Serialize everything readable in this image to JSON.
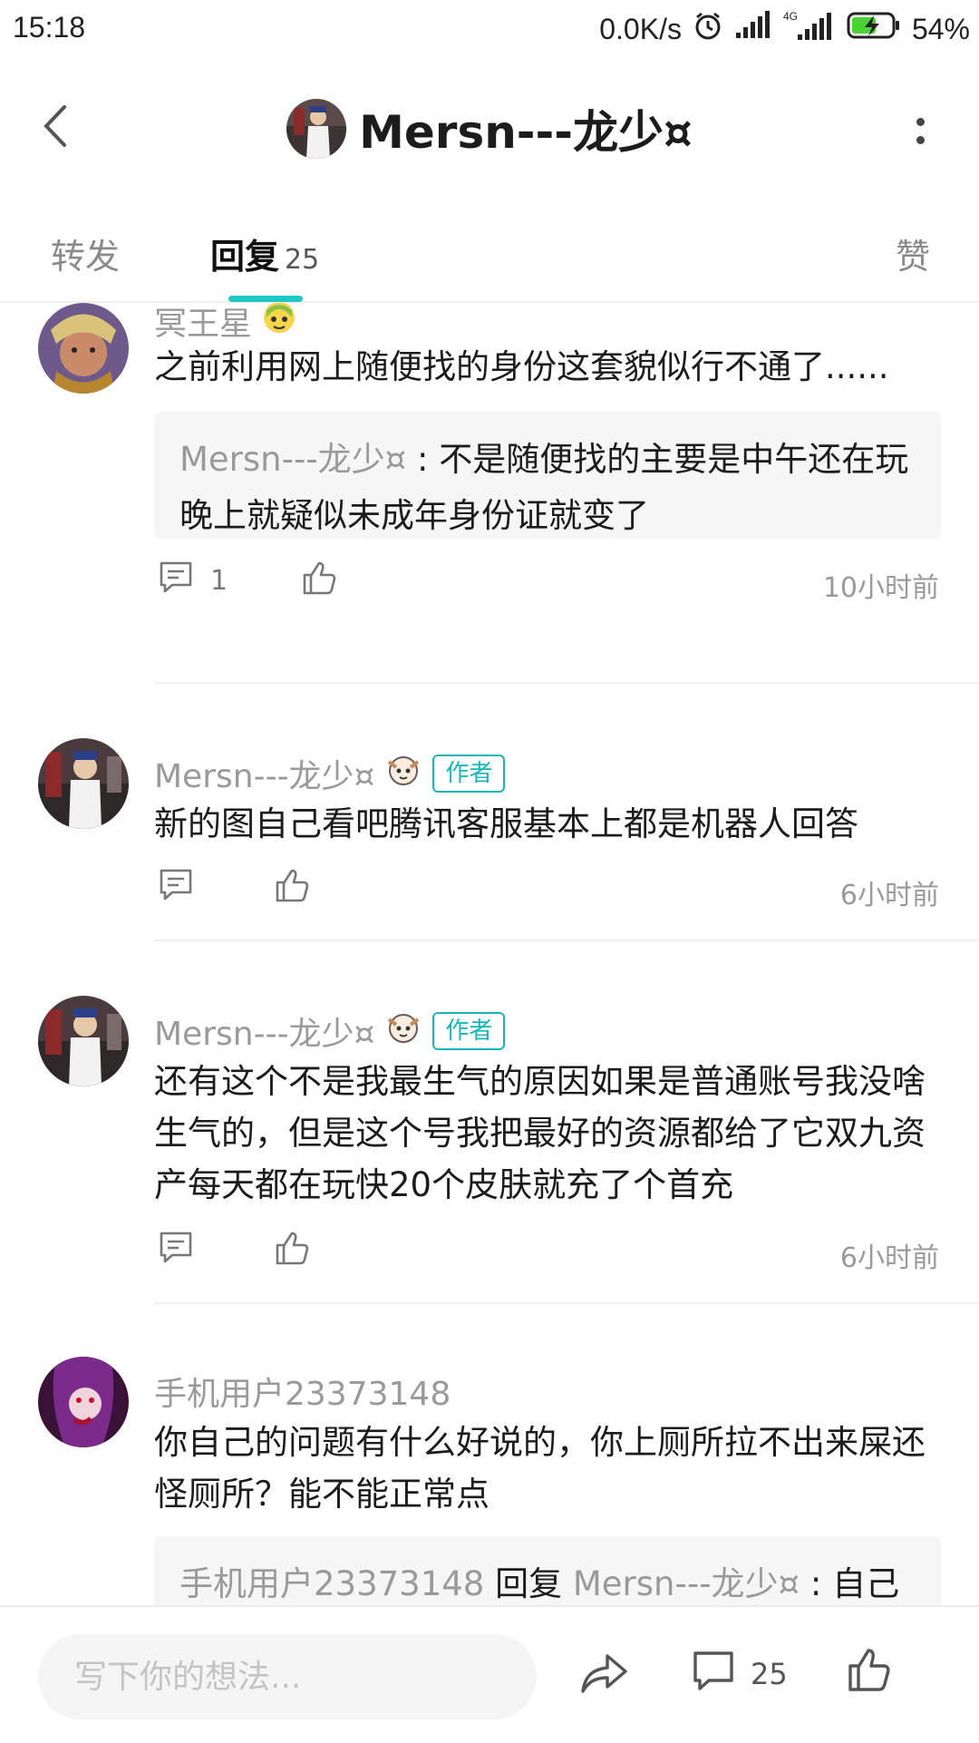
{
  "status_bar": {
    "time": "15:18",
    "net_speed": "0.0K/s",
    "network_type": "4G",
    "battery": "54%",
    "icons": [
      "alarm-icon",
      "signal-icon",
      "signal-4g-icon",
      "battery-charging-icon"
    ]
  },
  "header": {
    "title": "Mersn---龙少¤",
    "back_icon": "chevron-left-icon",
    "more_icon": "more-vertical-icon"
  },
  "tabs": {
    "forward": "转发",
    "reply": "回复",
    "reply_count": "25",
    "like": "赞",
    "accent": "#1ec8c8"
  },
  "comments": [
    {
      "name": "冥王星",
      "text": "之前利用网上随便找的身份这套貌似行不通了......",
      "quote_name": "Mersn---龙少¤",
      "quote_sep": " : ",
      "quote_text": "不是随便找的主要是中午还在玩晚上就疑似未成年身份证就变了",
      "reply_count": "1",
      "time": "10小时前"
    },
    {
      "name": "Mersn---龙少¤",
      "badge": "作者",
      "text": "新的图自己看吧腾讯客服基本上都是机器人回答",
      "time": "6小时前"
    },
    {
      "name": "Mersn---龙少¤",
      "badge": "作者",
      "text": "还有这个不是我最生气的原因如果是普通账号我没啥生气的，但是这个号我把最好的资源都给了它双九资产每天都在玩快20个皮肤就充了个首充",
      "time": "6小时前"
    },
    {
      "name": "手机用户23373148",
      "text": "你自己的问题有什么好说的，你上厕所拉不出来屎还怪厕所？能不能正常点",
      "quote_name": "手机用户23373148",
      "quote_mid": " 回复 ",
      "quote_target": "Mersn---龙少¤",
      "quote_sep": " : ",
      "quote_text": "自己"
    }
  ],
  "bottom_bar": {
    "placeholder": "写下你的想法...",
    "comment_count": "25"
  }
}
